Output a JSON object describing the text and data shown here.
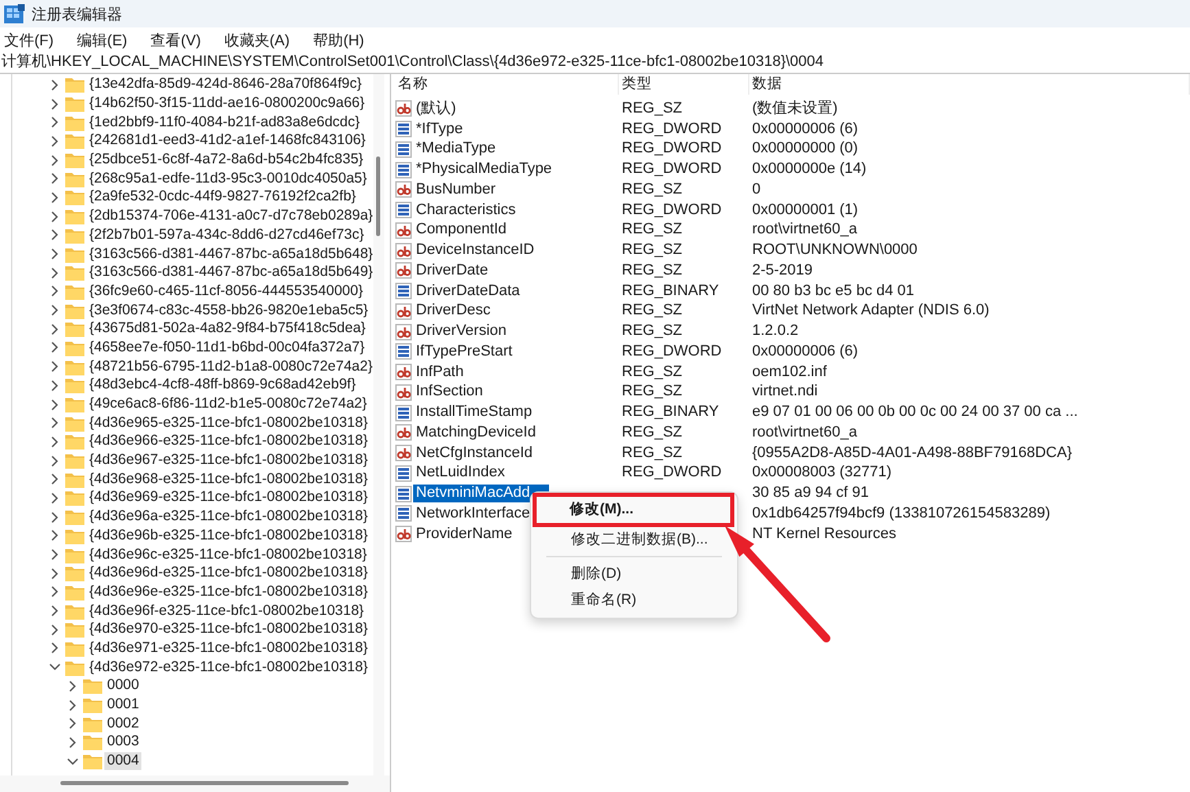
{
  "window": {
    "title": "注册表编辑器"
  },
  "menu": [
    "文件(F)",
    "编辑(E)",
    "查看(V)",
    "收藏夹(A)",
    "帮助(H)"
  ],
  "address": "计算机\\HKEY_LOCAL_MACHINE\\SYSTEM\\ControlSet001\\Control\\Class\\{4d36e972-e325-11ce-bfc1-08002be10318}\\0004",
  "tree": [
    {
      "label": "{13e42dfa-85d9-424d-8646-28a70f864f9c}",
      "expanded": false,
      "selected": false
    },
    {
      "label": "{14b62f50-3f15-11dd-ae16-0800200c9a66}",
      "expanded": false,
      "selected": false
    },
    {
      "label": "{1ed2bbf9-11f0-4084-b21f-ad83a8e6dcdc}",
      "expanded": false,
      "selected": false
    },
    {
      "label": "{242681d1-eed3-41d2-a1ef-1468fc843106}",
      "expanded": false,
      "selected": false
    },
    {
      "label": "{25dbce51-6c8f-4a72-8a6d-b54c2b4fc835}",
      "expanded": false,
      "selected": false
    },
    {
      "label": "{268c95a1-edfe-11d3-95c3-0010dc4050a5}",
      "expanded": false,
      "selected": false
    },
    {
      "label": "{2a9fe532-0cdc-44f9-9827-76192f2ca2fb}",
      "expanded": false,
      "selected": false
    },
    {
      "label": "{2db15374-706e-4131-a0c7-d7c78eb0289a}",
      "expanded": false,
      "selected": false
    },
    {
      "label": "{2f2b7b01-597a-434c-8dd6-d27cd46ef73c}",
      "expanded": false,
      "selected": false
    },
    {
      "label": "{3163c566-d381-4467-87bc-a65a18d5b648}",
      "expanded": false,
      "selected": false
    },
    {
      "label": "{3163c566-d381-4467-87bc-a65a18d5b649}",
      "expanded": false,
      "selected": false
    },
    {
      "label": "{36fc9e60-c465-11cf-8056-444553540000}",
      "expanded": false,
      "selected": false
    },
    {
      "label": "{3e3f0674-c83c-4558-bb26-9820e1eba5c5}",
      "expanded": false,
      "selected": false
    },
    {
      "label": "{43675d81-502a-4a82-9f84-b75f418c5dea}",
      "expanded": false,
      "selected": false
    },
    {
      "label": "{4658ee7e-f050-11d1-b6bd-00c04fa372a7}",
      "expanded": false,
      "selected": false
    },
    {
      "label": "{48721b56-6795-11d2-b1a8-0080c72e74a2}",
      "expanded": false,
      "selected": false
    },
    {
      "label": "{48d3ebc4-4cf8-48ff-b869-9c68ad42eb9f}",
      "expanded": false,
      "selected": false
    },
    {
      "label": "{49ce6ac8-6f86-11d2-b1e5-0080c72e74a2}",
      "expanded": false,
      "selected": false
    },
    {
      "label": "{4d36e965-e325-11ce-bfc1-08002be10318}",
      "expanded": false,
      "selected": false
    },
    {
      "label": "{4d36e966-e325-11ce-bfc1-08002be10318}",
      "expanded": false,
      "selected": false
    },
    {
      "label": "{4d36e967-e325-11ce-bfc1-08002be10318}",
      "expanded": false,
      "selected": false
    },
    {
      "label": "{4d36e968-e325-11ce-bfc1-08002be10318}",
      "expanded": false,
      "selected": false
    },
    {
      "label": "{4d36e969-e325-11ce-bfc1-08002be10318}",
      "expanded": false,
      "selected": false
    },
    {
      "label": "{4d36e96a-e325-11ce-bfc1-08002be10318}",
      "expanded": false,
      "selected": false
    },
    {
      "label": "{4d36e96b-e325-11ce-bfc1-08002be10318}",
      "expanded": false,
      "selected": false
    },
    {
      "label": "{4d36e96c-e325-11ce-bfc1-08002be10318}",
      "expanded": false,
      "selected": false
    },
    {
      "label": "{4d36e96d-e325-11ce-bfc1-08002be10318}",
      "expanded": false,
      "selected": false
    },
    {
      "label": "{4d36e96e-e325-11ce-bfc1-08002be10318}",
      "expanded": false,
      "selected": false
    },
    {
      "label": "{4d36e96f-e325-11ce-bfc1-08002be10318}",
      "expanded": false,
      "selected": false
    },
    {
      "label": "{4d36e970-e325-11ce-bfc1-08002be10318}",
      "expanded": false,
      "selected": false
    },
    {
      "label": "{4d36e971-e325-11ce-bfc1-08002be10318}",
      "expanded": false,
      "selected": false
    },
    {
      "label": "{4d36e972-e325-11ce-bfc1-08002be10318}",
      "expanded": true,
      "selected": false,
      "children": [
        {
          "label": "0000",
          "expanded": false,
          "selected": false
        },
        {
          "label": "0001",
          "expanded": false,
          "selected": false
        },
        {
          "label": "0002",
          "expanded": false,
          "selected": false
        },
        {
          "label": "0003",
          "expanded": false,
          "selected": false
        },
        {
          "label": "0004",
          "expanded": true,
          "selected": true
        }
      ]
    }
  ],
  "values": {
    "columns": [
      "名称",
      "类型",
      "数据"
    ],
    "rows": [
      {
        "kind": "string",
        "name": "(默认)",
        "type": "REG_SZ",
        "data": "(数值未设置)",
        "selected": false
      },
      {
        "kind": "binary",
        "name": "*IfType",
        "type": "REG_DWORD",
        "data": "0x00000006 (6)",
        "selected": false
      },
      {
        "kind": "binary",
        "name": "*MediaType",
        "type": "REG_DWORD",
        "data": "0x00000000 (0)",
        "selected": false
      },
      {
        "kind": "binary",
        "name": "*PhysicalMediaType",
        "type": "REG_DWORD",
        "data": "0x0000000e (14)",
        "selected": false
      },
      {
        "kind": "string",
        "name": "BusNumber",
        "type": "REG_SZ",
        "data": "0",
        "selected": false
      },
      {
        "kind": "binary",
        "name": "Characteristics",
        "type": "REG_DWORD",
        "data": "0x00000001 (1)",
        "selected": false
      },
      {
        "kind": "string",
        "name": "ComponentId",
        "type": "REG_SZ",
        "data": "root\\virtnet60_a",
        "selected": false
      },
      {
        "kind": "string",
        "name": "DeviceInstanceID",
        "type": "REG_SZ",
        "data": "ROOT\\UNKNOWN\\0000",
        "selected": false
      },
      {
        "kind": "string",
        "name": "DriverDate",
        "type": "REG_SZ",
        "data": "2-5-2019",
        "selected": false
      },
      {
        "kind": "binary",
        "name": "DriverDateData",
        "type": "REG_BINARY",
        "data": "00 80 b3 bc e5 bc d4 01",
        "selected": false
      },
      {
        "kind": "string",
        "name": "DriverDesc",
        "type": "REG_SZ",
        "data": "VirtNet Network Adapter (NDIS 6.0)",
        "selected": false
      },
      {
        "kind": "string",
        "name": "DriverVersion",
        "type": "REG_SZ",
        "data": "1.2.0.2",
        "selected": false
      },
      {
        "kind": "binary",
        "name": "IfTypePreStart",
        "type": "REG_DWORD",
        "data": "0x00000006 (6)",
        "selected": false
      },
      {
        "kind": "string",
        "name": "InfPath",
        "type": "REG_SZ",
        "data": "oem102.inf",
        "selected": false
      },
      {
        "kind": "string",
        "name": "InfSection",
        "type": "REG_SZ",
        "data": "virtnet.ndi",
        "selected": false
      },
      {
        "kind": "binary",
        "name": "InstallTimeStamp",
        "type": "REG_BINARY",
        "data": "e9 07 01 00 06 00 0b 00 0c 00 24 00 37 00 ca ...",
        "selected": false
      },
      {
        "kind": "string",
        "name": "MatchingDeviceId",
        "type": "REG_SZ",
        "data": "root\\virtnet60_a",
        "selected": false
      },
      {
        "kind": "string",
        "name": "NetCfgInstanceId",
        "type": "REG_SZ",
        "data": "{0955A2D8-A85D-4A01-A498-88BF79168DCA}",
        "selected": false
      },
      {
        "kind": "binary",
        "name": "NetLuidIndex",
        "type": "REG_DWORD",
        "data": "0x00008003 (32771)",
        "selected": false
      },
      {
        "kind": "binary",
        "name": "NetvminiMacAdd",
        "data": "30 85 a9 94 cf 91",
        "selected": true
      },
      {
        "kind": "binary",
        "name": "NetworkInterface",
        "data": "0x1db64257f94bcf9 (133810726154583289)",
        "selected": false
      },
      {
        "kind": "string",
        "name": "ProviderName",
        "data": "NT Kernel Resources",
        "selected": false
      }
    ]
  },
  "context_menu": {
    "items": [
      {
        "kind": "item",
        "label": "修改(M)...",
        "default": true,
        "highlighted": true
      },
      {
        "kind": "item",
        "label": "修改二进制数据(B)...",
        "default": false,
        "highlighted": false
      },
      {
        "kind": "separator"
      },
      {
        "kind": "item",
        "label": "删除(D)",
        "default": false,
        "highlighted": false
      },
      {
        "kind": "item",
        "label": "重命名(R)",
        "default": false,
        "highlighted": false
      }
    ]
  }
}
